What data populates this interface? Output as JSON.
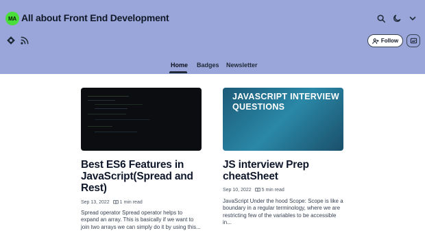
{
  "blog": {
    "logo_initials": "MA",
    "title": "All about Front End Development"
  },
  "header": {
    "follow_label": "Follow"
  },
  "nav": {
    "items": [
      {
        "label": "Home",
        "active": true
      },
      {
        "label": "Badges",
        "active": false
      },
      {
        "label": "Newsletter",
        "active": false
      }
    ]
  },
  "articles": [
    {
      "cover": "code-screenshot",
      "title": "Best ES6 Features in JavaScript(Spread and Rest)",
      "date": "Sep 13, 2022",
      "read_time": "1 min read",
      "excerpt": "Spread operator Spread operator helps to expand an array. This is basically if we want to join two arrays we can simply do it by using this..."
    },
    {
      "cover": "javascript-interview-questions",
      "cover_text": "JAVASCRIPT INTERVIEW QUESTIONS",
      "title": "JS interview Prep cheatSheet",
      "date": "Sep 10, 2022",
      "read_time": "5 min read",
      "excerpt": "JavaScript Under the hood Scope: Scope is like a boundary in a regular terminology, where we are restricting few of the variables to be accessible in..."
    }
  ],
  "colors": {
    "header_bg": "#9aa6d9",
    "logo_bg": "#4ade3a",
    "card2_bg": "#2a88a7"
  },
  "icons": [
    "search-icon",
    "moon-icon",
    "chevron-down-icon",
    "hashnode-icon",
    "rss-icon",
    "user-plus-icon",
    "newsletter-icon",
    "book-icon"
  ]
}
